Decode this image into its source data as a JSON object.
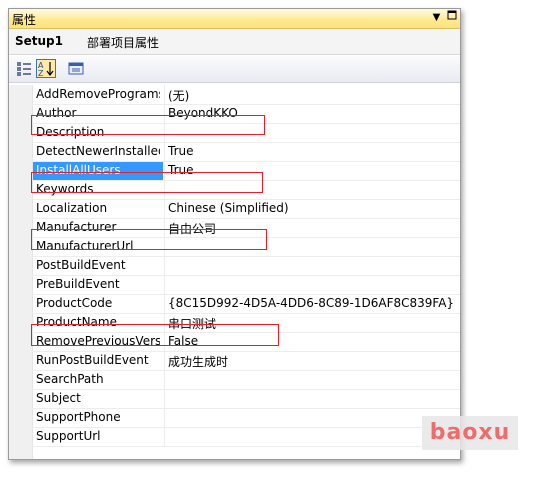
{
  "window": {
    "title": "属性"
  },
  "object": {
    "name": "Setup1",
    "description": "部署项目属性"
  },
  "toolbar": {
    "icons": [
      "categorized-icon",
      "alphabetical-icon",
      "property-pages-icon"
    ]
  },
  "properties": [
    {
      "key": "AddRemoveProgramsIcon",
      "value": "(无)"
    },
    {
      "key": "Author",
      "value": "BeyondKKO"
    },
    {
      "key": "Description",
      "value": ""
    },
    {
      "key": "DetectNewerInstalledVersion",
      "value": "True"
    },
    {
      "key": "InstallAllUsers",
      "value": "True"
    },
    {
      "key": "Keywords",
      "value": ""
    },
    {
      "key": "Localization",
      "value": "Chinese (Simplified)"
    },
    {
      "key": "Manufacturer",
      "value": "自由公司"
    },
    {
      "key": "ManufacturerUrl",
      "value": ""
    },
    {
      "key": "PostBuildEvent",
      "value": ""
    },
    {
      "key": "PreBuildEvent",
      "value": ""
    },
    {
      "key": "ProductCode",
      "value": "{8C15D992-4D5A-4DD6-8C89-1D6AF8C839FA}"
    },
    {
      "key": "ProductName",
      "value": "串口测试"
    },
    {
      "key": "RemovePreviousVersions",
      "value": "False"
    },
    {
      "key": "RunPostBuildEvent",
      "value": "成功生成时"
    },
    {
      "key": "SearchPath",
      "value": ""
    },
    {
      "key": "Subject",
      "value": ""
    },
    {
      "key": "SupportPhone",
      "value": ""
    },
    {
      "key": "SupportUrl",
      "value": ""
    }
  ],
  "selected_property": "InstallAllUsers",
  "highlighted_properties": [
    "Author",
    "InstallAllUsers",
    "Manufacturer",
    "ProductName"
  ],
  "watermark": "baoxu",
  "colors": {
    "titlebar": "#ffe98f",
    "selection": "#3399ff",
    "highlight_box": "#e0202a"
  }
}
